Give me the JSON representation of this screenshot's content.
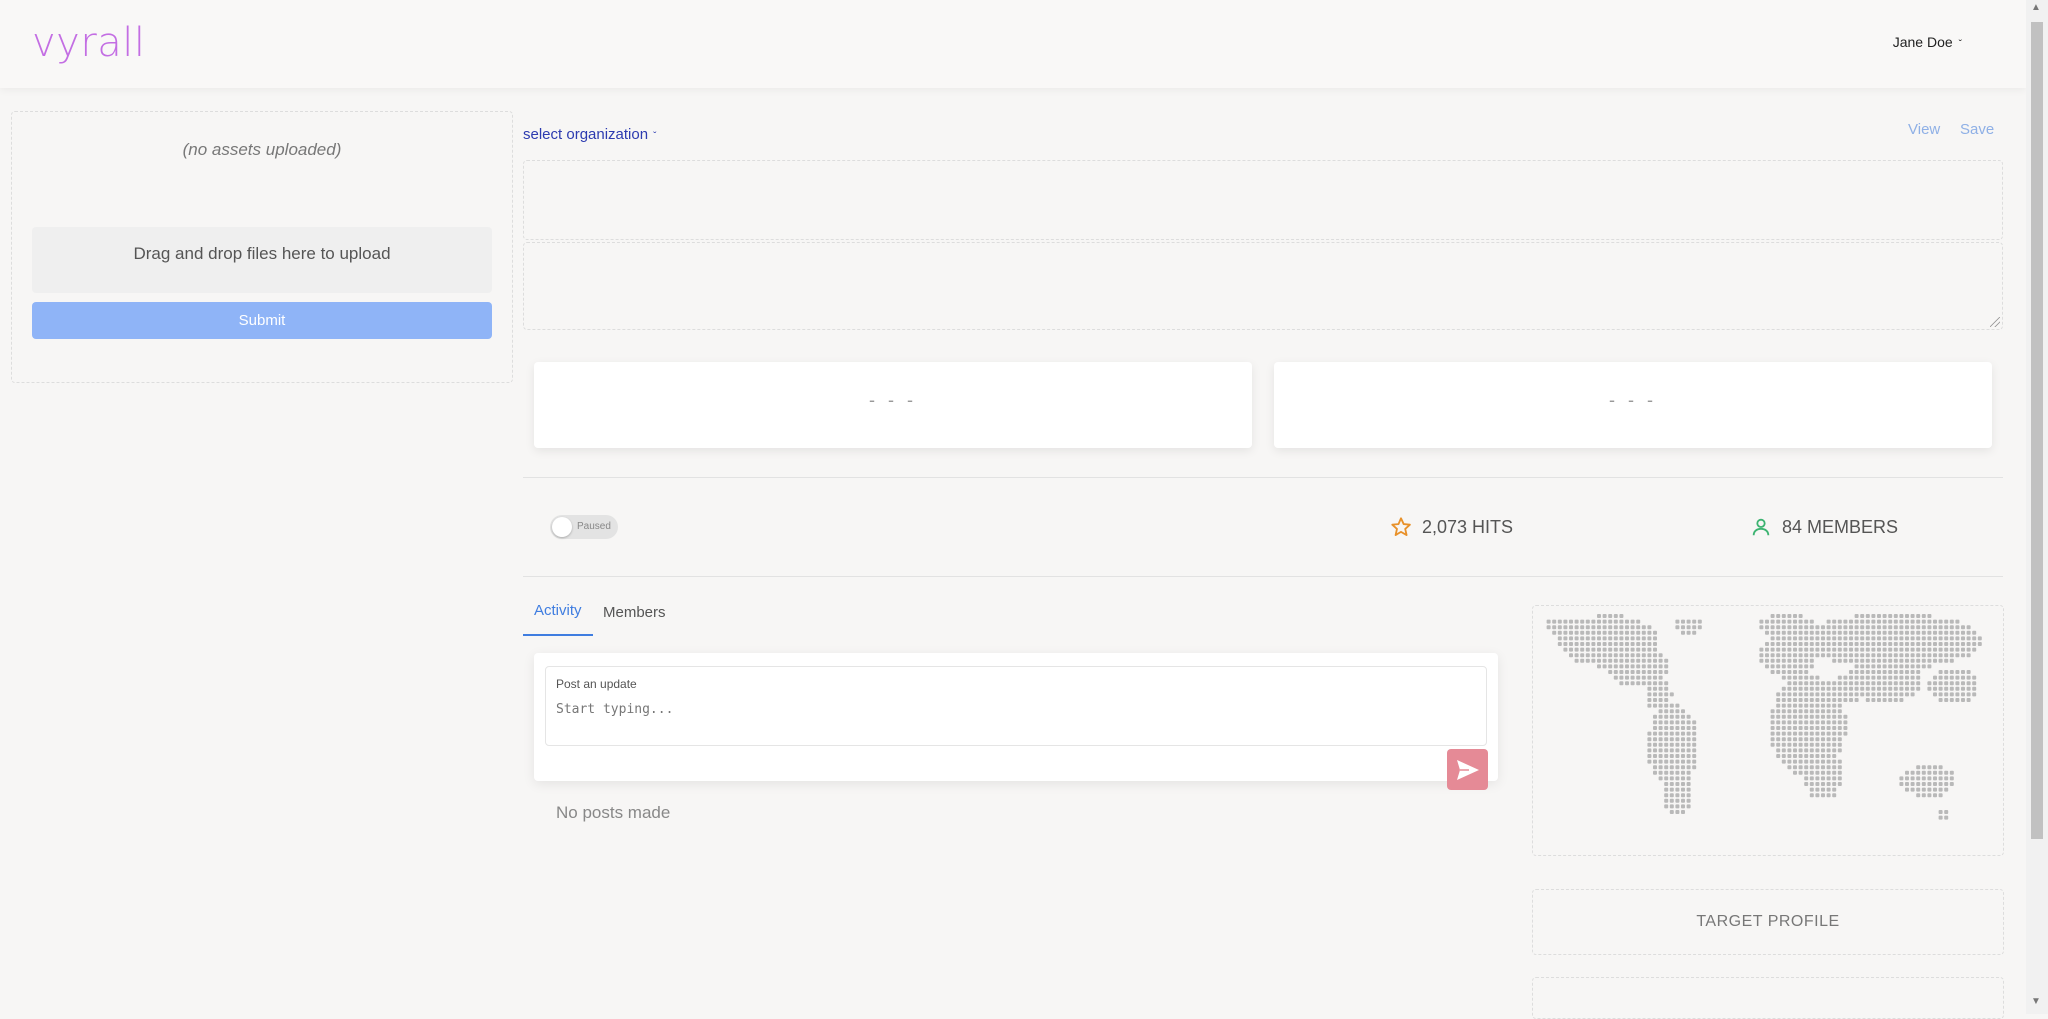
{
  "app": {
    "logo": "vyrall"
  },
  "header": {
    "user_name": "Jane Doe",
    "user_chevron": "ˇ"
  },
  "upload": {
    "empty_text": "(no assets uploaded)",
    "dropzone_text": "Drag and drop files here to upload",
    "submit_label": "Submit",
    "submit_color": "#8fb4f7"
  },
  "campaign": {
    "org_select_label": "select organization",
    "org_chevron": "ˇ",
    "view_label": "View",
    "save_label": "Save"
  },
  "metrics": {
    "card_left_value": "- - -",
    "card_right_value": "- - -"
  },
  "status": {
    "toggle_label": "Paused",
    "toggle_on": false,
    "hits": "2,073 HITS",
    "members": "84 MEMBERS",
    "hits_icon": "star-icon",
    "members_icon": "person-icon",
    "hits_icon_color": "#e8912a",
    "members_icon_color": "#3cb371"
  },
  "tabs": [
    {
      "label": "Activity",
      "active": true
    },
    {
      "label": "Members",
      "active": false
    }
  ],
  "post": {
    "label": "Post an update",
    "placeholder": "Start typing...",
    "send_icon": "send-icon",
    "send_color": "#e58a96",
    "empty_text": "No posts made"
  },
  "sidebar": {
    "map_icon": "world-map-dots",
    "target_profile_label": "TARGET PROFILE"
  }
}
